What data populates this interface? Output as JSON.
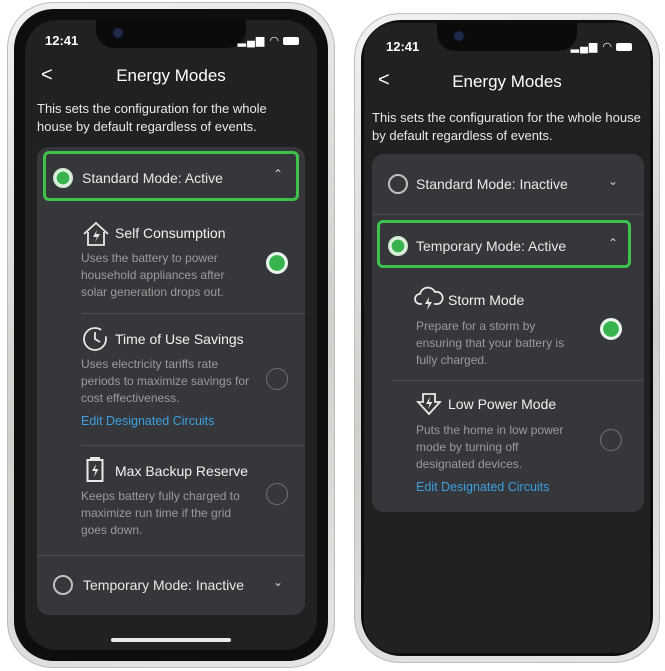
{
  "left": {
    "time": "12:41",
    "status": "▂▄▆ ◠",
    "back": "<",
    "title": "Energy Modes",
    "description": "This sets the configuration for the whole house by default regardless of events.",
    "standard_mode": "Standard Mode: Active",
    "temporary_mode": "Temporary Mode: Inactive",
    "options": [
      {
        "icon": "house-solar-icon",
        "title": "Self Consumption",
        "desc": "Uses the battery to power household appliances after solar generation drops out.",
        "selected": true
      },
      {
        "icon": "clock-icon",
        "title": "Time of Use Savings",
        "desc": "Uses electricity tariffs rate periods to maximize savings for cost effectiveness.",
        "link": "Edit Designated Circuits",
        "selected": false
      },
      {
        "icon": "battery-icon",
        "title": "Max Backup Reserve",
        "desc": "Keeps battery fully charged to maximize run time if the grid goes down.",
        "selected": false
      }
    ]
  },
  "right": {
    "time": "12:41",
    "status": "▂▄▆ ◠",
    "back": "<",
    "title": "Energy Modes",
    "description": "This sets the configuration for the whole house by default regardless of events.",
    "standard_mode": "Standard Mode: Inactive",
    "temporary_mode": "Temporary Mode: Active",
    "options": [
      {
        "icon": "storm-cloud-icon",
        "title": "Storm Mode",
        "desc": "Prepare for a storm by ensuring that your battery is fully charged.",
        "selected": true
      },
      {
        "icon": "low-power-icon",
        "title": "Low Power Mode",
        "desc": "Puts the home in low power mode by turning off designated devices.",
        "link": "Edit Designated Circuits",
        "selected": false
      }
    ]
  },
  "colors": {
    "accent_green": "#3fc24c",
    "link_blue": "#3d9fe0",
    "background": "#202123",
    "card": "#35373a"
  }
}
